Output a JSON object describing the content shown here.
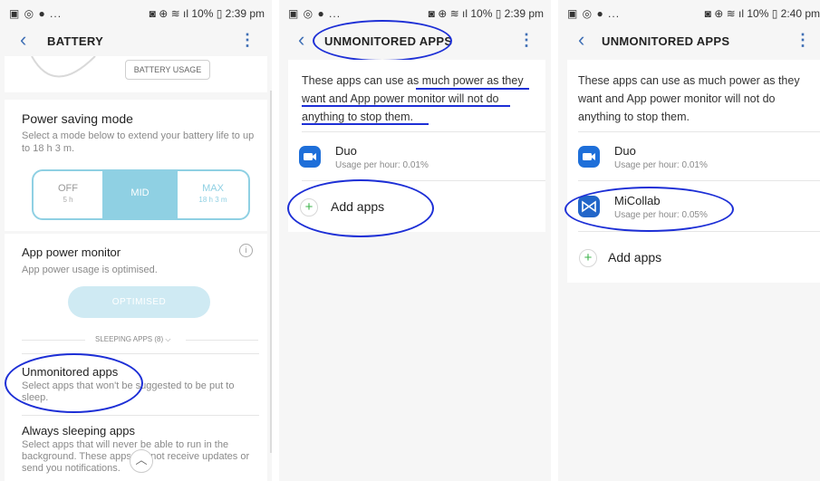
{
  "panel1": {
    "status_left": "▣ ◎ ● ...",
    "status_right": "◙ ⊕ ≋ ıl 10% ▯ 2:39 pm",
    "title": "BATTERY",
    "battery_usage_button": "BATTERY USAGE",
    "power_saving": {
      "title": "Power saving mode",
      "description": "Select a mode below to extend your battery life to up to 18 h 3 m.",
      "modes": [
        {
          "label": "OFF",
          "sub": "5 h"
        },
        {
          "label": "MID",
          "sub": ""
        },
        {
          "label": "MAX",
          "sub": "18 h 3 m"
        }
      ],
      "selected": "MID"
    },
    "app_power_monitor": {
      "title": "App power monitor",
      "description": "App power usage is optimised.",
      "button": "OPTIMISED",
      "info_icon": "info-icon"
    },
    "sleeping_apps": "SLEEPING APPS (8)",
    "unmonitored": {
      "title": "Unmonitored apps",
      "description": "Select apps that won't be suggested to be put to sleep."
    },
    "always_sleeping": {
      "title": "Always sleeping apps",
      "description": "Select apps that will never be able to run in the background. These apps will not receive updates or send you notifications."
    },
    "scroll_up_glyph": "︿"
  },
  "panel2": {
    "status_left": "▣ ◎ ● ...",
    "status_right": "◙ ⊕ ≋ ıl 10% ▯ 2:39 pm",
    "title": "UNMONITORED APPS",
    "description_line1": "These apps can use as much power as they",
    "description_line2": "want and App power monitor will not do",
    "description_line3": "anything to stop them.",
    "apps": [
      {
        "name": "Duo",
        "usage": "Usage per hour: 0.01%",
        "icon": "duo-icon"
      }
    ],
    "add_apps": "Add apps"
  },
  "panel3": {
    "status_left": "▣ ◎ ● ...",
    "status_right": "◙ ⊕ ≋ ıl 10% ▯ 2:40 pm",
    "title": "UNMONITORED APPS",
    "description_line1": "These apps can use as much power as they",
    "description_line2": "want and App power monitor will not do",
    "description_line3": "anything to stop them.",
    "apps": [
      {
        "name": "Duo",
        "usage": "Usage per hour: 0.01%",
        "icon": "duo-icon"
      },
      {
        "name": "MiCollab",
        "usage": "Usage per hour: 0.05%",
        "icon": "micollab-icon"
      }
    ],
    "add_apps": "Add apps"
  },
  "colors": {
    "accent": "#3f6fb5",
    "mode_selected": "#8fd0e3",
    "annotation": "#1d2fd6",
    "add_plus": "#3bb34a"
  }
}
